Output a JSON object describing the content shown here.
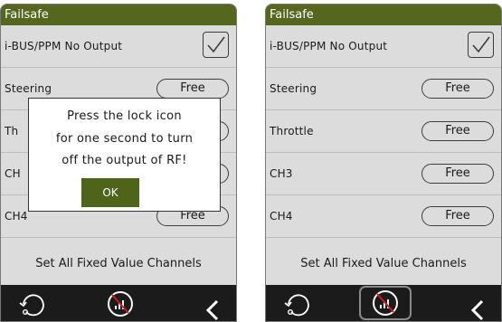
{
  "left": {
    "title": "Failsafe",
    "ibus_label": "i-BUS/PPM No Output",
    "steering_label": "Steering",
    "steering_value": "Free",
    "throttle_label_fragment": "Th",
    "ch3_label_fragment": "CH",
    "ch4_label": "CH4",
    "ch4_value": "Free",
    "set_all_label": "Set All Fixed Value Channels",
    "dialog": {
      "line1": "Press the lock icon",
      "line2": "for one second to turn",
      "line3": "off the output of RF!",
      "ok_label": "OK"
    }
  },
  "right": {
    "title": "Failsafe",
    "ibus_label": "i-BUS/PPM No Output",
    "steering_label": "Steering",
    "steering_value": "Free",
    "throttle_label": "Throttle",
    "throttle_value": "Free",
    "ch3_label": "CH3",
    "ch3_value": "Free",
    "ch4_label": "CH4",
    "ch4_value": "Free",
    "set_all_label": "Set All Fixed Value Channels"
  },
  "icons": {
    "back": "back-rotate-icon",
    "rf_off": "rf-output-off-icon",
    "chevron": "chevron-left-icon",
    "checkmark": "checkmark-icon"
  },
  "colors": {
    "accent": "#55671e",
    "ok_button": "#4e6418",
    "bottom_bar": "#1b1b1b",
    "screen_bg": "#dcdcdc",
    "rf_slash": "#d01a1a"
  }
}
